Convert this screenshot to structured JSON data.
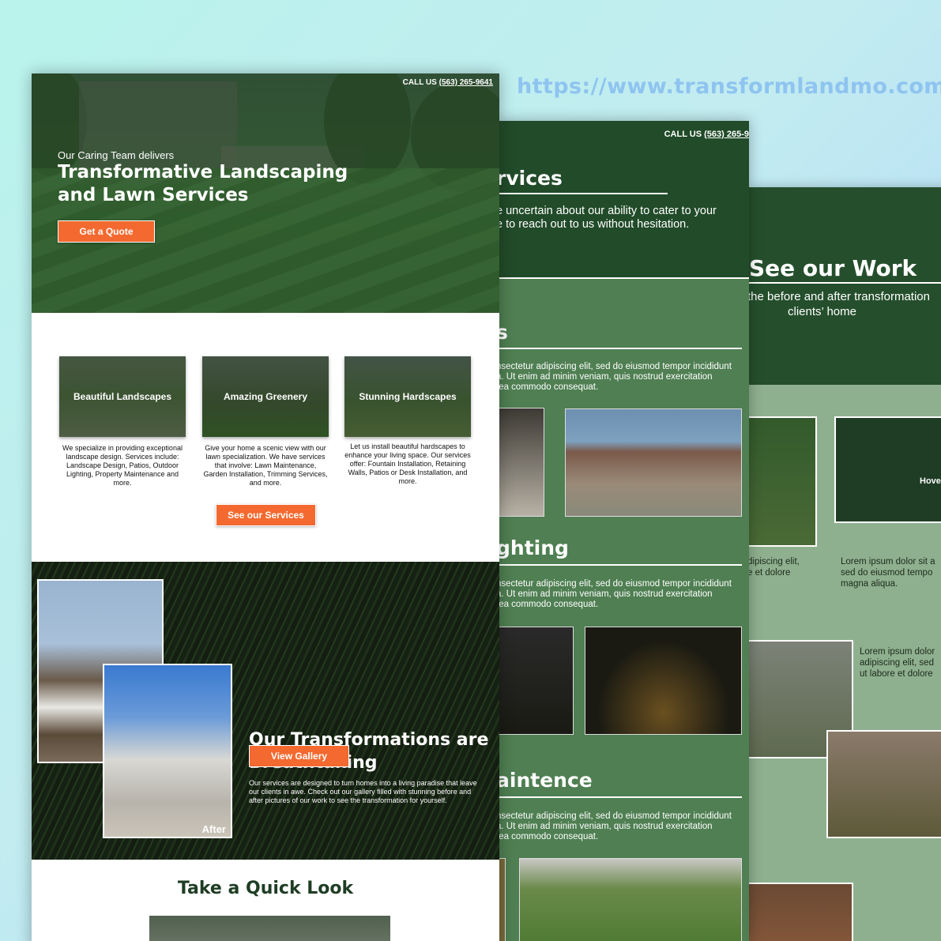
{
  "site_url": "https://www.transformlandmo.com",
  "page3": {
    "title": "See our Work",
    "subtitle_line1": "the before and after transformation",
    "subtitle_line2": "clients’ home",
    "hover_label": "Hove",
    "text_a": "dipiscing elit,\ne et dolore",
    "text_b": "Lorem ipsum dolor sit a\nsed do eiusmod tempo\nmagna aliqua.",
    "text_c": "Lorem ipsum dolor\nadipiscing elit, sed\nut labore et dolore"
  },
  "page2": {
    "call_label": "CALL US",
    "phone": "(563) 265-9",
    "services_title": "rvices",
    "hero_text": "e uncertain about our ability to cater to your\ne to reach out to us without hesitation.",
    "section1_title": "s",
    "section2_title": "ghting",
    "section3_title": "aintence",
    "lorem": "nsectetur adipiscing elit, sed do eiusmod tempor incididunt\na. Ut enim ad minim veniam, quis nostrud exercitation\n ea commodo consequat."
  },
  "page1": {
    "call_label": "CALL US",
    "phone": "(563) 265-9641",
    "hero_pre": "Our Caring Team delivers",
    "hero_title": "Transformative Landscaping and Lawn Services",
    "quote_button": "Get a Quote",
    "services": [
      {
        "label": "Beautiful Landscapes",
        "desc": "We specialize in providing exceptional landscape design. Services include: Landscape Design, Patios, Outdoor Lighting, Property Maintenance and more."
      },
      {
        "label": "Amazing Greenery",
        "desc": "Give your home a scenic view with our lawn specialization. We have services that involve: Lawn Maintenance, Garden Installation, Trimming Services, and more."
      },
      {
        "label": "Stunning Hardscapes",
        "desc": "Let us install beautiful hardscapes to enhance your living space. Our services offer: Fountain Installation, Retaining Walls, Patios or Desk Installation, and more."
      }
    ],
    "services_button": "See our Services",
    "transform_title": "Our Transformations are Breathtaking",
    "transform_desc": "Our services are designed to turn homes into a living paradise that leave our clients in awe. Check out our gallery filled with stunning before and after pictures of our work to see the transformation for yourself.",
    "gallery_button": "View Gallery",
    "after_label": "After",
    "quick_title": "Take a Quick Look"
  }
}
